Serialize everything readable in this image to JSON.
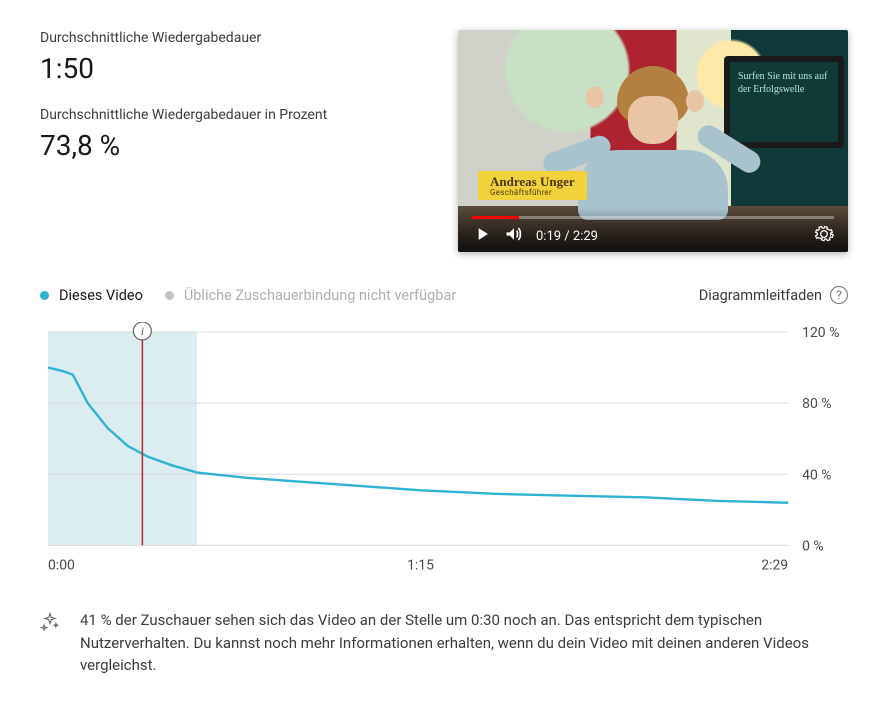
{
  "stats": {
    "avg_view_duration_label": "Durchschnittliche Wiedergabedauer",
    "avg_view_duration_value": "1:50",
    "avg_view_pct_label": "Durchschnittliche Wiedergabedauer in Prozent",
    "avg_view_pct_value": "73,8 %"
  },
  "video_overlay": {
    "lower_third_name": "Andreas Unger",
    "lower_third_role": "Geschäftsführer",
    "monitor_slogan": "Surfen Sie mit uns auf der Erfolgswelle",
    "current_time": "0:19",
    "total_time": "2:29"
  },
  "legend": {
    "this_video": "Dieses Video",
    "typical_unavailable": "Übliche Zuschauerbindung nicht verfügbar",
    "guide": "Diagrammleitfaden",
    "help_glyph": "?"
  },
  "chart_data": {
    "type": "line",
    "title": "",
    "xlabel": "",
    "ylabel": "",
    "x_unit": "seconds",
    "x_range": [
      0,
      149
    ],
    "ylim": [
      0,
      120
    ],
    "y_ticks": [
      0,
      40,
      80,
      120
    ],
    "y_tick_labels": [
      "0 %",
      "40 %",
      "80 %",
      "120 %"
    ],
    "x_tick_seconds": [
      0,
      75,
      149
    ],
    "x_tick_labels": [
      "0:00",
      "1:15",
      "2:29"
    ],
    "highlight_band_seconds": [
      0,
      30
    ],
    "marker_seconds": 19,
    "series": [
      {
        "name": "Dieses Video",
        "color": "#2fb3d2",
        "x_seconds": [
          0,
          3,
          5,
          8,
          12,
          16,
          20,
          25,
          30,
          40,
          50,
          60,
          75,
          90,
          105,
          120,
          135,
          149
        ],
        "values": [
          100,
          98,
          96,
          80,
          66,
          56,
          50,
          45,
          41,
          38,
          36,
          34,
          31,
          29,
          28,
          27,
          25,
          24
        ]
      }
    ]
  },
  "insight": {
    "text": "41 % der Zuschauer sehen sich das Video an der Stelle um 0:30 noch an. Das entspricht dem typischen Nutzerverhalten. Du kannst noch mehr Informationen erhalten, wenn du dein Video mit deinen anderen Videos vergleichst."
  }
}
